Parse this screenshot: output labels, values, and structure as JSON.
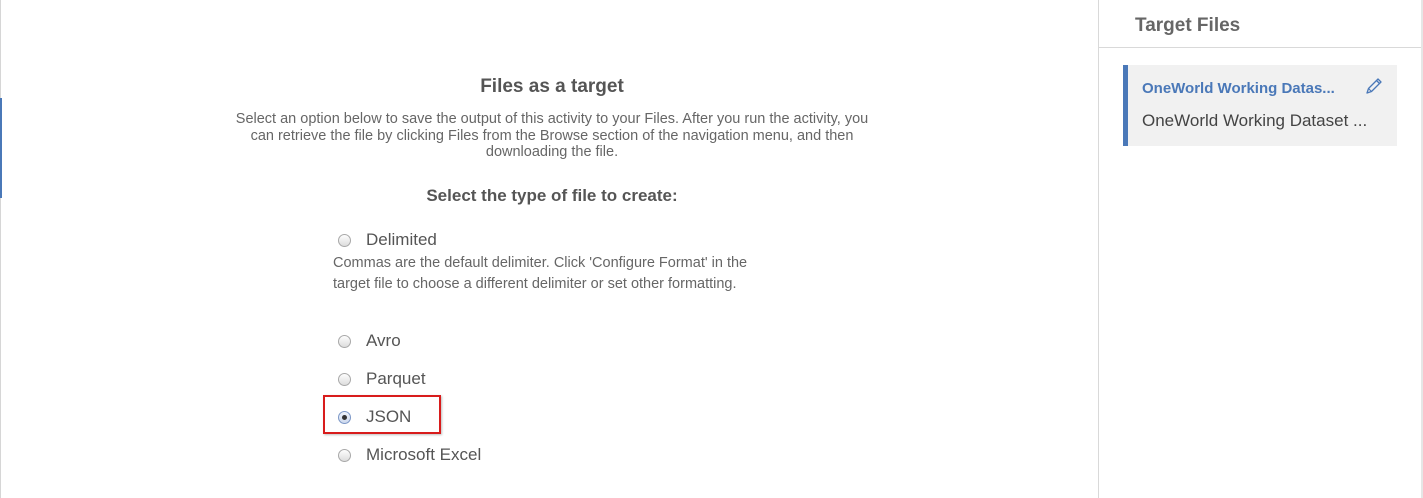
{
  "main": {
    "title": "Files as a target",
    "description": "Select an option below to save the output of this activity to your Files. After you run the activity, you can retrieve the file by clicking Files from the Browse section of the navigation menu, and then downloading the file.",
    "subtitle": "Select the type of file to create:",
    "options": [
      {
        "label": "Delimited",
        "checked": false
      },
      {
        "label": "Avro",
        "checked": false
      },
      {
        "label": "Parquet",
        "checked": false
      },
      {
        "label": "JSON",
        "checked": true
      },
      {
        "label": "Microsoft Excel",
        "checked": false
      }
    ],
    "delimited_help": "Commas are the default delimiter. Click 'Configure Format' in the target file to choose a different delimiter or set other formatting."
  },
  "target_files": {
    "title": "Target Files",
    "file": {
      "title": "OneWorld Working Datas...",
      "subtitle": "OneWorld Working Dataset ..."
    }
  },
  "colors": {
    "accent": "#4a78b8",
    "highlight": "#d81c1c"
  }
}
